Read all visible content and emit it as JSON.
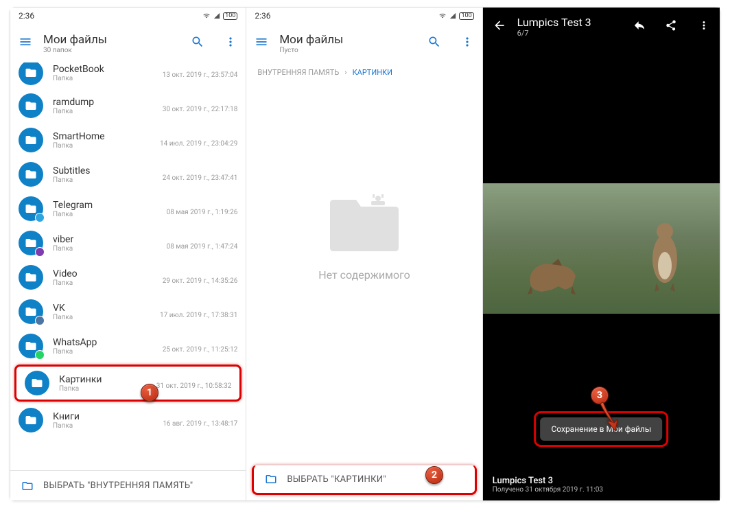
{
  "statusbar": {
    "time": "2:36",
    "battery": "100"
  },
  "pane1": {
    "title": "Мои файлы",
    "subtitle": "30 папок",
    "folders": [
      {
        "name": "PocketBook",
        "sub": "Папка",
        "date": "13 окт. 2019 г., 23:57:04",
        "badge": null
      },
      {
        "name": "ramdump",
        "sub": "Папка",
        "date": "30 окт. 2019 г., 22:17:18",
        "badge": null
      },
      {
        "name": "SmartHome",
        "sub": "Папка",
        "date": "14 июл. 2019 г., 23:04:29",
        "badge": null
      },
      {
        "name": "Subtitles",
        "sub": "Папка",
        "date": "24 окт. 2019 г., 23:47:41",
        "badge": null
      },
      {
        "name": "Telegram",
        "sub": "Папка",
        "date": "08 мая 2019 г., 1:19:26",
        "badge": "#2ca5e0"
      },
      {
        "name": "viber",
        "sub": "Папка",
        "date": "08 мая 2019 г., 1:47:24",
        "badge": "#7d3daf"
      },
      {
        "name": "Video",
        "sub": "Папка",
        "date": "29 окт. 2019 г., 14:35:26",
        "badge": null
      },
      {
        "name": "VK",
        "sub": "Папка",
        "date": "17 июл. 2019 г., 17:38:31",
        "badge": "#4c75a3"
      },
      {
        "name": "WhatsApp",
        "sub": "Папка",
        "date": "25 окт. 2019 г., 11:25:12",
        "badge": "#25d366"
      },
      {
        "name": "Картинки",
        "sub": "Папка",
        "date": "31 окт. 2019 г., 10:58:32",
        "badge": null
      },
      {
        "name": "Книги",
        "sub": "Папка",
        "date": "16 авг. 2019 г., 13:48:17",
        "badge": null
      }
    ],
    "bottomAction": "ВЫБРАТЬ \"ВНУТРЕННЯЯ ПАМЯТЬ\""
  },
  "pane2": {
    "title": "Мои файлы",
    "subtitle": "Пусто",
    "breadcrumb": {
      "root": "ВНУТРЕННЯЯ ПАМЯТЬ",
      "current": "КАРТИНКИ"
    },
    "emptyText": "Нет содержимого",
    "bottomAction": "ВЫБРАТЬ \"КАРТИНКИ\""
  },
  "pane3": {
    "title": "Lumpics Test 3",
    "counter": "6/7",
    "toast": "Сохранение в Мои файлы",
    "footerTitle": "Lumpics Test 3",
    "footerDate": "Получено 31 октября 2019 г. 11:03"
  },
  "callouts": {
    "c1": "1",
    "c2": "2",
    "c3": "3"
  }
}
